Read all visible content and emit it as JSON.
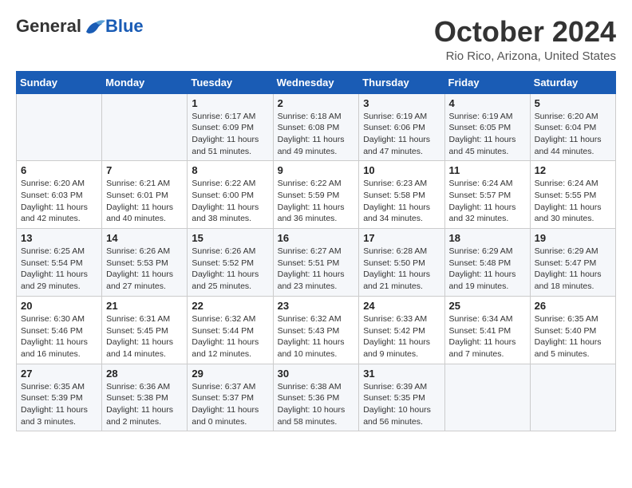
{
  "header": {
    "logo": {
      "general": "General",
      "blue": "Blue"
    },
    "month": "October 2024",
    "location": "Rio Rico, Arizona, United States"
  },
  "weekdays": [
    "Sunday",
    "Monday",
    "Tuesday",
    "Wednesday",
    "Thursday",
    "Friday",
    "Saturday"
  ],
  "weeks": [
    [
      {
        "day": "",
        "info": ""
      },
      {
        "day": "",
        "info": ""
      },
      {
        "day": "1",
        "info": "Sunrise: 6:17 AM\nSunset: 6:09 PM\nDaylight: 11 hours and 51 minutes."
      },
      {
        "day": "2",
        "info": "Sunrise: 6:18 AM\nSunset: 6:08 PM\nDaylight: 11 hours and 49 minutes."
      },
      {
        "day": "3",
        "info": "Sunrise: 6:19 AM\nSunset: 6:06 PM\nDaylight: 11 hours and 47 minutes."
      },
      {
        "day": "4",
        "info": "Sunrise: 6:19 AM\nSunset: 6:05 PM\nDaylight: 11 hours and 45 minutes."
      },
      {
        "day": "5",
        "info": "Sunrise: 6:20 AM\nSunset: 6:04 PM\nDaylight: 11 hours and 44 minutes."
      }
    ],
    [
      {
        "day": "6",
        "info": "Sunrise: 6:20 AM\nSunset: 6:03 PM\nDaylight: 11 hours and 42 minutes."
      },
      {
        "day": "7",
        "info": "Sunrise: 6:21 AM\nSunset: 6:01 PM\nDaylight: 11 hours and 40 minutes."
      },
      {
        "day": "8",
        "info": "Sunrise: 6:22 AM\nSunset: 6:00 PM\nDaylight: 11 hours and 38 minutes."
      },
      {
        "day": "9",
        "info": "Sunrise: 6:22 AM\nSunset: 5:59 PM\nDaylight: 11 hours and 36 minutes."
      },
      {
        "day": "10",
        "info": "Sunrise: 6:23 AM\nSunset: 5:58 PM\nDaylight: 11 hours and 34 minutes."
      },
      {
        "day": "11",
        "info": "Sunrise: 6:24 AM\nSunset: 5:57 PM\nDaylight: 11 hours and 32 minutes."
      },
      {
        "day": "12",
        "info": "Sunrise: 6:24 AM\nSunset: 5:55 PM\nDaylight: 11 hours and 30 minutes."
      }
    ],
    [
      {
        "day": "13",
        "info": "Sunrise: 6:25 AM\nSunset: 5:54 PM\nDaylight: 11 hours and 29 minutes."
      },
      {
        "day": "14",
        "info": "Sunrise: 6:26 AM\nSunset: 5:53 PM\nDaylight: 11 hours and 27 minutes."
      },
      {
        "day": "15",
        "info": "Sunrise: 6:26 AM\nSunset: 5:52 PM\nDaylight: 11 hours and 25 minutes."
      },
      {
        "day": "16",
        "info": "Sunrise: 6:27 AM\nSunset: 5:51 PM\nDaylight: 11 hours and 23 minutes."
      },
      {
        "day": "17",
        "info": "Sunrise: 6:28 AM\nSunset: 5:50 PM\nDaylight: 11 hours and 21 minutes."
      },
      {
        "day": "18",
        "info": "Sunrise: 6:29 AM\nSunset: 5:48 PM\nDaylight: 11 hours and 19 minutes."
      },
      {
        "day": "19",
        "info": "Sunrise: 6:29 AM\nSunset: 5:47 PM\nDaylight: 11 hours and 18 minutes."
      }
    ],
    [
      {
        "day": "20",
        "info": "Sunrise: 6:30 AM\nSunset: 5:46 PM\nDaylight: 11 hours and 16 minutes."
      },
      {
        "day": "21",
        "info": "Sunrise: 6:31 AM\nSunset: 5:45 PM\nDaylight: 11 hours and 14 minutes."
      },
      {
        "day": "22",
        "info": "Sunrise: 6:32 AM\nSunset: 5:44 PM\nDaylight: 11 hours and 12 minutes."
      },
      {
        "day": "23",
        "info": "Sunrise: 6:32 AM\nSunset: 5:43 PM\nDaylight: 11 hours and 10 minutes."
      },
      {
        "day": "24",
        "info": "Sunrise: 6:33 AM\nSunset: 5:42 PM\nDaylight: 11 hours and 9 minutes."
      },
      {
        "day": "25",
        "info": "Sunrise: 6:34 AM\nSunset: 5:41 PM\nDaylight: 11 hours and 7 minutes."
      },
      {
        "day": "26",
        "info": "Sunrise: 6:35 AM\nSunset: 5:40 PM\nDaylight: 11 hours and 5 minutes."
      }
    ],
    [
      {
        "day": "27",
        "info": "Sunrise: 6:35 AM\nSunset: 5:39 PM\nDaylight: 11 hours and 3 minutes."
      },
      {
        "day": "28",
        "info": "Sunrise: 6:36 AM\nSunset: 5:38 PM\nDaylight: 11 hours and 2 minutes."
      },
      {
        "day": "29",
        "info": "Sunrise: 6:37 AM\nSunset: 5:37 PM\nDaylight: 11 hours and 0 minutes."
      },
      {
        "day": "30",
        "info": "Sunrise: 6:38 AM\nSunset: 5:36 PM\nDaylight: 10 hours and 58 minutes."
      },
      {
        "day": "31",
        "info": "Sunrise: 6:39 AM\nSunset: 5:35 PM\nDaylight: 10 hours and 56 minutes."
      },
      {
        "day": "",
        "info": ""
      },
      {
        "day": "",
        "info": ""
      }
    ]
  ]
}
